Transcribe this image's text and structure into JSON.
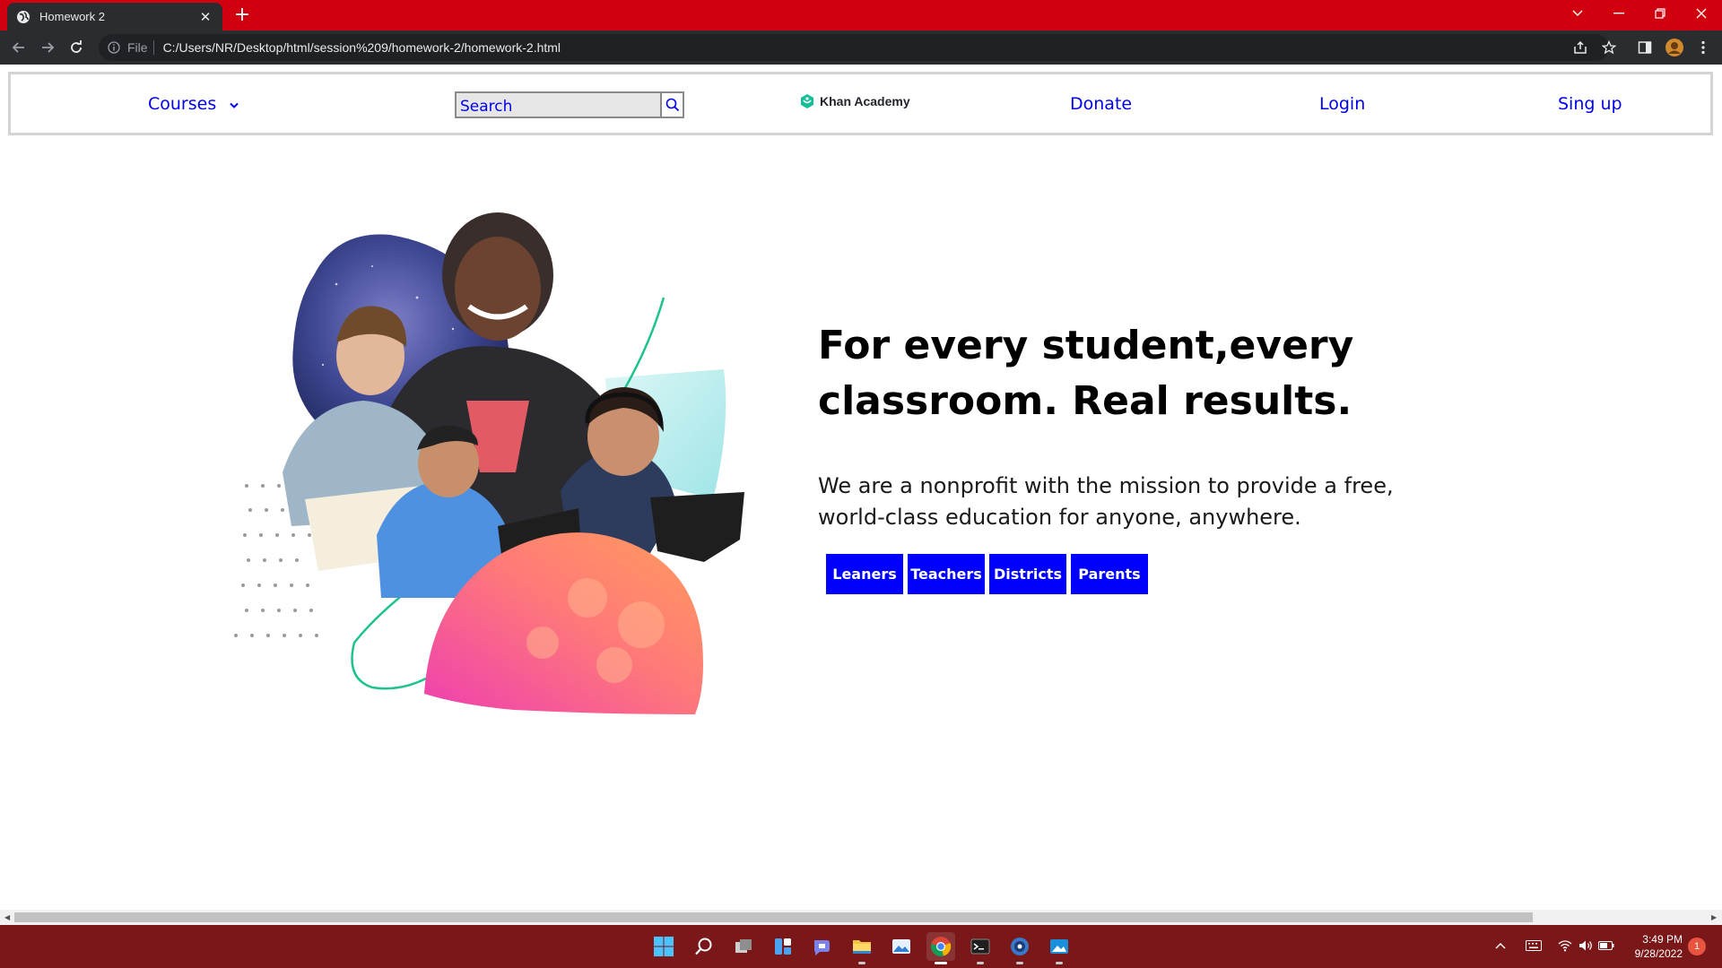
{
  "browser": {
    "tab_title": "Homework 2",
    "tab_close_glyph": "✕",
    "new_tab_glyph": "+",
    "scheme_label": "File",
    "url": "C:/Users/NR/Desktop/html/session%209/homework-2/homework-2.html",
    "accent_color": "#d1000f"
  },
  "site_nav": {
    "courses_label": "Courses",
    "search_placeholder": "Search",
    "brand_name": "Khan Academy",
    "donate_label": "Donate",
    "login_label": "Login",
    "signup_label": "Sing up",
    "link_color": "#0000ee"
  },
  "hero": {
    "title": "For every student,every classroom. Real results.",
    "subtitle": "We are a nonprofit with the mission to provide a free, world-class education for anyone, anywhere.",
    "buttons": [
      "Leaners",
      "Teachers",
      "Districts",
      "Parents"
    ],
    "button_color": "#0000ff",
    "image_icon": "students-collage"
  },
  "taskbar": {
    "apps": [
      "windows-start-icon",
      "search-icon",
      "task-view-icon",
      "widgets-icon",
      "teams-chat-icon",
      "file-explorer-icon",
      "photos-icon",
      "chrome-icon",
      "terminal-icon",
      "app-icon",
      "media-icon"
    ],
    "time": "3:49 PM",
    "date": "9/28/2022",
    "notification_count": "1",
    "background_color": "#7a1718"
  }
}
